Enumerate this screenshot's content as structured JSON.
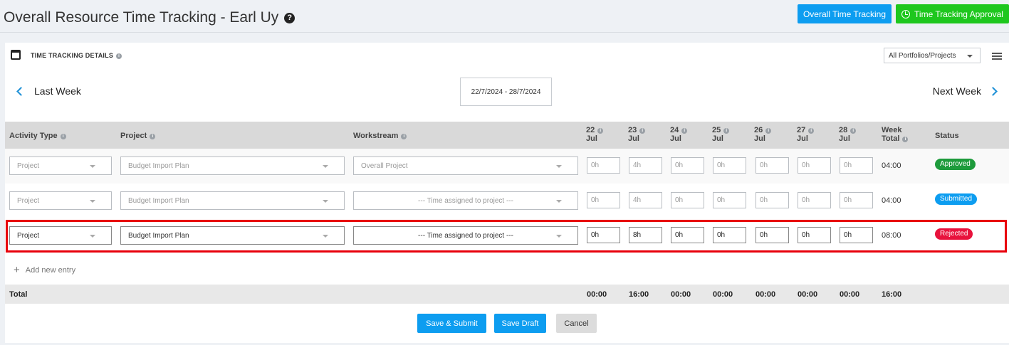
{
  "header": {
    "title": "Overall Resource Time Tracking - Earl Uy",
    "overall_btn": "Overall Time Tracking",
    "approval_btn": "Time Tracking Approval"
  },
  "card": {
    "title": "TIME TRACKING DETAILS",
    "portfolio_filter": "All Portfolios/Projects",
    "prev_label": "Last Week",
    "next_label": "Next Week",
    "date_range": "22/7/2024 - 28/7/2024"
  },
  "columns": {
    "activity": "Activity Type",
    "project": "Project",
    "workstream": "Workstream",
    "days": [
      {
        "d": "22",
        "m": "Jul"
      },
      {
        "d": "23",
        "m": "Jul"
      },
      {
        "d": "24",
        "m": "Jul"
      },
      {
        "d": "25",
        "m": "Jul"
      },
      {
        "d": "26",
        "m": "Jul"
      },
      {
        "d": "27",
        "m": "Jul"
      },
      {
        "d": "28",
        "m": "Jul"
      }
    ],
    "week_total_1": "Week",
    "week_total_2": "Total",
    "status": "Status"
  },
  "rows": [
    {
      "activity": "Project",
      "project": "Budget Import Plan",
      "workstream": "Overall Project",
      "hours": [
        "0h",
        "4h",
        "0h",
        "0h",
        "0h",
        "0h",
        "0h"
      ],
      "total": "04:00",
      "status": "Approved",
      "status_color": "#1e9b3c"
    },
    {
      "activity": "Project",
      "project": "Budget Import Plan",
      "workstream": "--- Time assigned to project ---",
      "hours": [
        "0h",
        "4h",
        "0h",
        "0h",
        "0h",
        "0h",
        "0h"
      ],
      "total": "04:00",
      "status": "Submitted",
      "status_color": "#0d9df0"
    },
    {
      "activity": "Project",
      "project": "Budget Import Plan",
      "workstream": "--- Time assigned to project ---",
      "hours": [
        "0h",
        "8h",
        "0h",
        "0h",
        "0h",
        "0h",
        "0h"
      ],
      "total": "08:00",
      "status": "Rejected",
      "status_color": "#e8123c"
    }
  ],
  "add_entry": "Add new entry",
  "totals": {
    "label": "Total",
    "days": [
      "00:00",
      "16:00",
      "00:00",
      "00:00",
      "00:00",
      "00:00",
      "00:00"
    ],
    "week": "16:00"
  },
  "actions": {
    "submit": "Save & Submit",
    "draft": "Save Draft",
    "cancel": "Cancel"
  },
  "colors": {
    "primary": "#0d9df0",
    "success": "#1ec71e",
    "highlight": "#e8000b"
  }
}
